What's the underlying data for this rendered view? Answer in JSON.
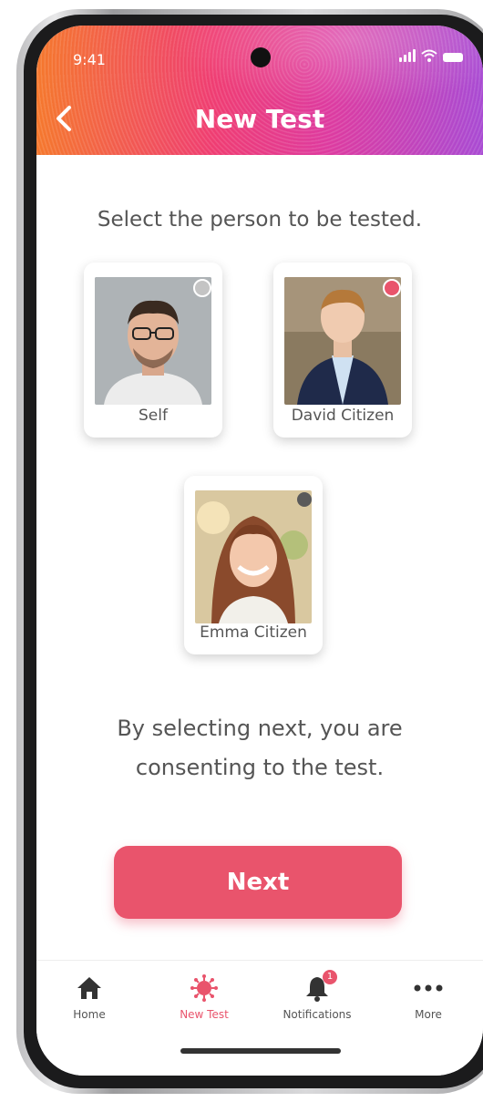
{
  "status": {
    "time": "9:41"
  },
  "header": {
    "title": "New Test"
  },
  "prompt": "Select the person to be tested.",
  "people": [
    {
      "label": "Self",
      "selected": false
    },
    {
      "label": "David Citizen",
      "selected": true
    },
    {
      "label": "Emma Citizen",
      "selected": false
    }
  ],
  "consent": {
    "line1": "By selecting next, you are",
    "line2": "consenting to the test."
  },
  "next_button": {
    "label": "Next"
  },
  "tabs": [
    {
      "label": "Home",
      "icon": "home-icon"
    },
    {
      "label": "New Test",
      "icon": "virus-icon"
    },
    {
      "label": "Notifications",
      "icon": "bell-icon",
      "badge": "1"
    },
    {
      "label": "More",
      "icon": "more-dots-icon"
    }
  ],
  "colors": {
    "accent": "#e9546c",
    "radio_off": "#bdbdbd",
    "radio_dark": "#5a5a5a"
  }
}
